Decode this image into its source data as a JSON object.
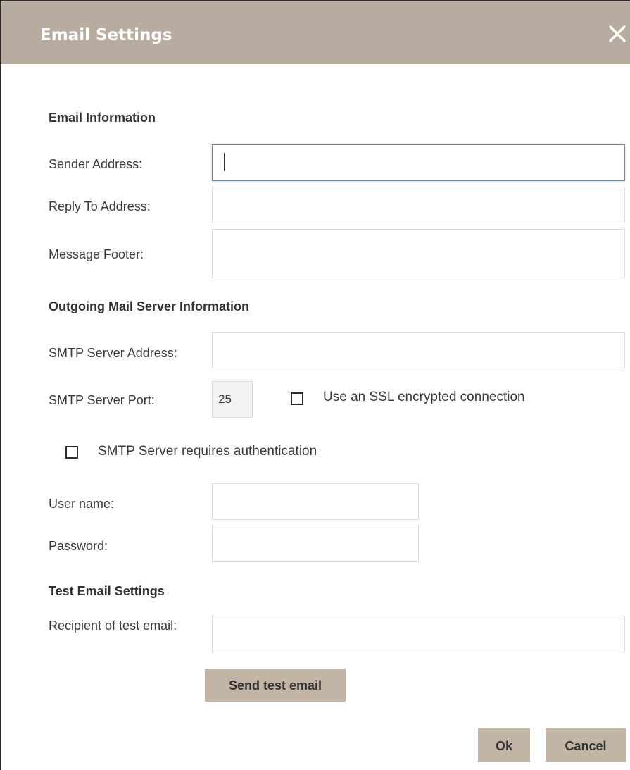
{
  "dialog": {
    "title": "Email Settings",
    "close_icon": "close-icon"
  },
  "email_info": {
    "section_title": "Email Information",
    "sender_label": "Sender Address:",
    "sender_value": "",
    "reply_label": "Reply To Address:",
    "reply_value": "",
    "footer_label": "Message Footer:",
    "footer_value": ""
  },
  "outgoing": {
    "section_title": "Outgoing Mail Server Information",
    "smtp_address_label": "SMTP Server Address:",
    "smtp_address_value": "",
    "smtp_port_label": "SMTP Server Port:",
    "smtp_port_value": "25",
    "ssl_label": "Use an SSL encrypted connection",
    "ssl_checked": false,
    "auth_label": "SMTP Server requires authentication",
    "auth_checked": false,
    "username_label": "User name:",
    "username_value": "",
    "password_label": "Password:",
    "password_value": ""
  },
  "test": {
    "section_title": "Test Email Settings",
    "recipient_label": "Recipient of test email:",
    "recipient_value": "",
    "send_button": "Send test email"
  },
  "footer": {
    "ok_button": "Ok",
    "cancel_button": "Cancel"
  },
  "colors": {
    "header_bg": "#b8aca1",
    "button_bg": "#c2b5a6"
  }
}
